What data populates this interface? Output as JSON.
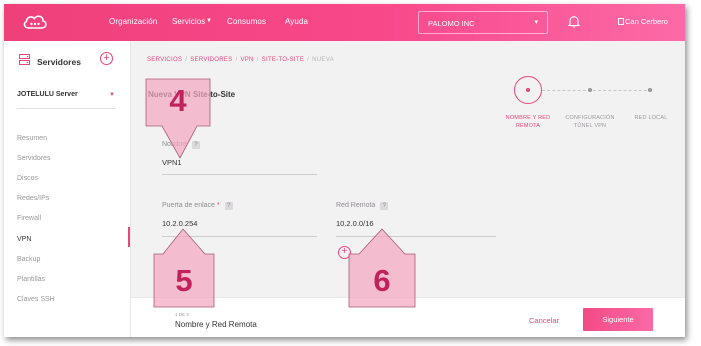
{
  "topbar": {
    "nav": [
      "Organización",
      "Servicios",
      "Consumos",
      "Ayuda"
    ],
    "company": "PALOMO INC",
    "user": "Can Cerbero"
  },
  "sidebar": {
    "title": "Servidores",
    "server": "JOTELULU Server",
    "items": [
      "Resumen",
      "Servidores",
      "Discos",
      "Redes/IPs",
      "Firewall",
      "VPN",
      "Backup",
      "Plantillas",
      "Claves SSH"
    ],
    "active_item": "VPN"
  },
  "breadcrumb": [
    "SERVICIOS",
    "SERVIDORES",
    "VPN",
    "SITE-TO-SITE",
    "NUEVA"
  ],
  "form": {
    "title": "Nueva VPN Site-to-Site",
    "name_label": "Nombre",
    "name_value": "VPN1",
    "gateway_label": "Puerta de enlace",
    "required_mark": "*",
    "gateway_value": "10.2.0.254",
    "remote_label": "Red Remota",
    "remote_value": "10.2.0.0/16",
    "help": "?",
    "add_symbol": "+"
  },
  "stepper": {
    "steps": [
      {
        "line1": "NOMBRE Y RED",
        "line2": "REMOTA"
      },
      {
        "line1": "CONFIGURACIÓN",
        "line2": "TÚNEL VPN"
      },
      {
        "line1": "RED LOCAL",
        "line2": ""
      }
    ],
    "current": 1
  },
  "footer": {
    "step_text": "1 DE 3",
    "step_name": "Nombre y Red Remota",
    "cancel": "Cancelar",
    "next": "Siguiente"
  },
  "annotations": [
    "4",
    "5",
    "6"
  ],
  "colors": {
    "accent": "#e8447e",
    "callout_fill": "#f4a6c0",
    "callout_text": "#c1225c"
  }
}
